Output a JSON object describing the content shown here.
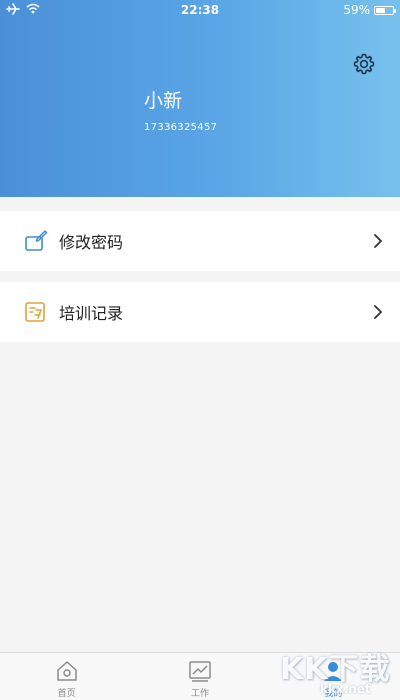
{
  "status_bar": {
    "time": "22:38",
    "battery_text": "59%",
    "battery_level": 0.59,
    "airplane_icon": "airplane-icon",
    "wifi_icon": "wifi-icon"
  },
  "profile": {
    "name": "小新",
    "phone": "17336325457",
    "settings_icon": "gear-icon"
  },
  "menu": [
    {
      "label": "修改密码",
      "icon": "edit-lock-icon",
      "icon_color": "#3b8bdc"
    },
    {
      "label": "培训记录",
      "icon": "training-record-icon",
      "icon_color": "#e0a23a"
    }
  ],
  "tabbar": {
    "tabs": [
      {
        "label": "首页",
        "icon": "home-icon",
        "active": false
      },
      {
        "label": "工作",
        "icon": "chart-icon",
        "active": false
      },
      {
        "label": "我的",
        "icon": "user-icon",
        "active": true
      }
    ]
  },
  "watermark": {
    "main": "KK下载",
    "sub": "kkx.net"
  },
  "colors": {
    "header_start": "#4a90d9",
    "header_end": "#76c1ec",
    "accent": "#3b8bdc",
    "background": "#f4f4f5"
  }
}
